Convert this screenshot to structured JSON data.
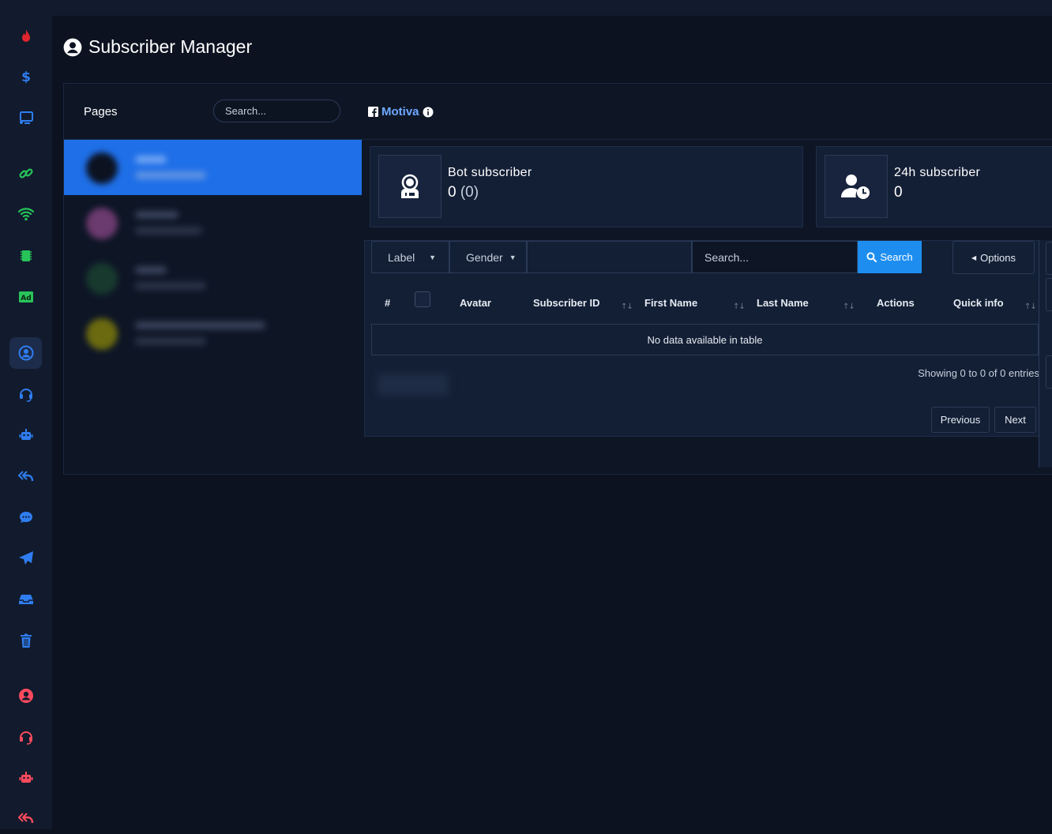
{
  "page": {
    "title": "Subscriber Manager",
    "title_icon": "user-circle-icon"
  },
  "sidebar": {
    "active_index": 8,
    "items": [
      {
        "icon": "fire-icon",
        "color": "#e1252d"
      },
      {
        "icon": "dollar-icon",
        "color": "#2f7df0"
      },
      {
        "icon": "cast-icon",
        "color": "#2f7df0"
      },
      {
        "icon": "link-icon",
        "color": "#28c45a"
      },
      {
        "icon": "wifi-icon",
        "color": "#28c45a"
      },
      {
        "icon": "chip-icon",
        "color": "#28c45a"
      },
      {
        "icon": "ad-icon",
        "color": "#28c45a"
      },
      {
        "icon": "user-circle-icon",
        "color": "#2f7df0"
      },
      {
        "icon": "headset-icon",
        "color": "#2f7df0"
      },
      {
        "icon": "robot-icon",
        "color": "#2f7df0"
      },
      {
        "icon": "reply-all-icon",
        "color": "#2f7df0"
      },
      {
        "icon": "chat-icon",
        "color": "#2f7df0"
      },
      {
        "icon": "send-icon",
        "color": "#2f7df0"
      },
      {
        "icon": "inbox-icon",
        "color": "#2f7df0"
      },
      {
        "icon": "trash-icon",
        "color": "#2f7df0"
      },
      {
        "icon": "user-circle-icon",
        "color": "#ff4a5e"
      },
      {
        "icon": "headset-icon",
        "color": "#ff4a5e"
      },
      {
        "icon": "robot-icon",
        "color": "#ff4a5e"
      },
      {
        "icon": "reply-all-icon",
        "color": "#ff4a5e"
      }
    ]
  },
  "pages_panel": {
    "label": "Pages",
    "search_placeholder": "Search...",
    "active_index": 0
  },
  "selected_page": {
    "name": "Motiva",
    "icon": "facebook-icon",
    "info_icon": "info-icon",
    "color": "#6fa8ff"
  },
  "stats": [
    {
      "label": "Bot subscriber",
      "value": "0",
      "sub": "(0)",
      "icon": "robot-face-icon"
    },
    {
      "label": "24h subscriber",
      "value": "0",
      "sub": "",
      "icon": "user-clock-icon"
    }
  ],
  "filters": {
    "label_select": "Label",
    "gender_select": "Gender",
    "search_placeholder": "Search...",
    "search_button": "Search",
    "options_button": "Options"
  },
  "table": {
    "columns": [
      "#",
      "Avatar",
      "Subscriber ID",
      "First Name",
      "Last Name",
      "Actions",
      "Quick info"
    ],
    "empty_text": "No data available in table",
    "info": "Showing 0 to 0 of 0 entries",
    "prev": "Previous",
    "next": "Next"
  },
  "colors": {
    "accent": "#1d8ef0",
    "active_row": "#1f6fe8",
    "background": "#0c1220"
  }
}
